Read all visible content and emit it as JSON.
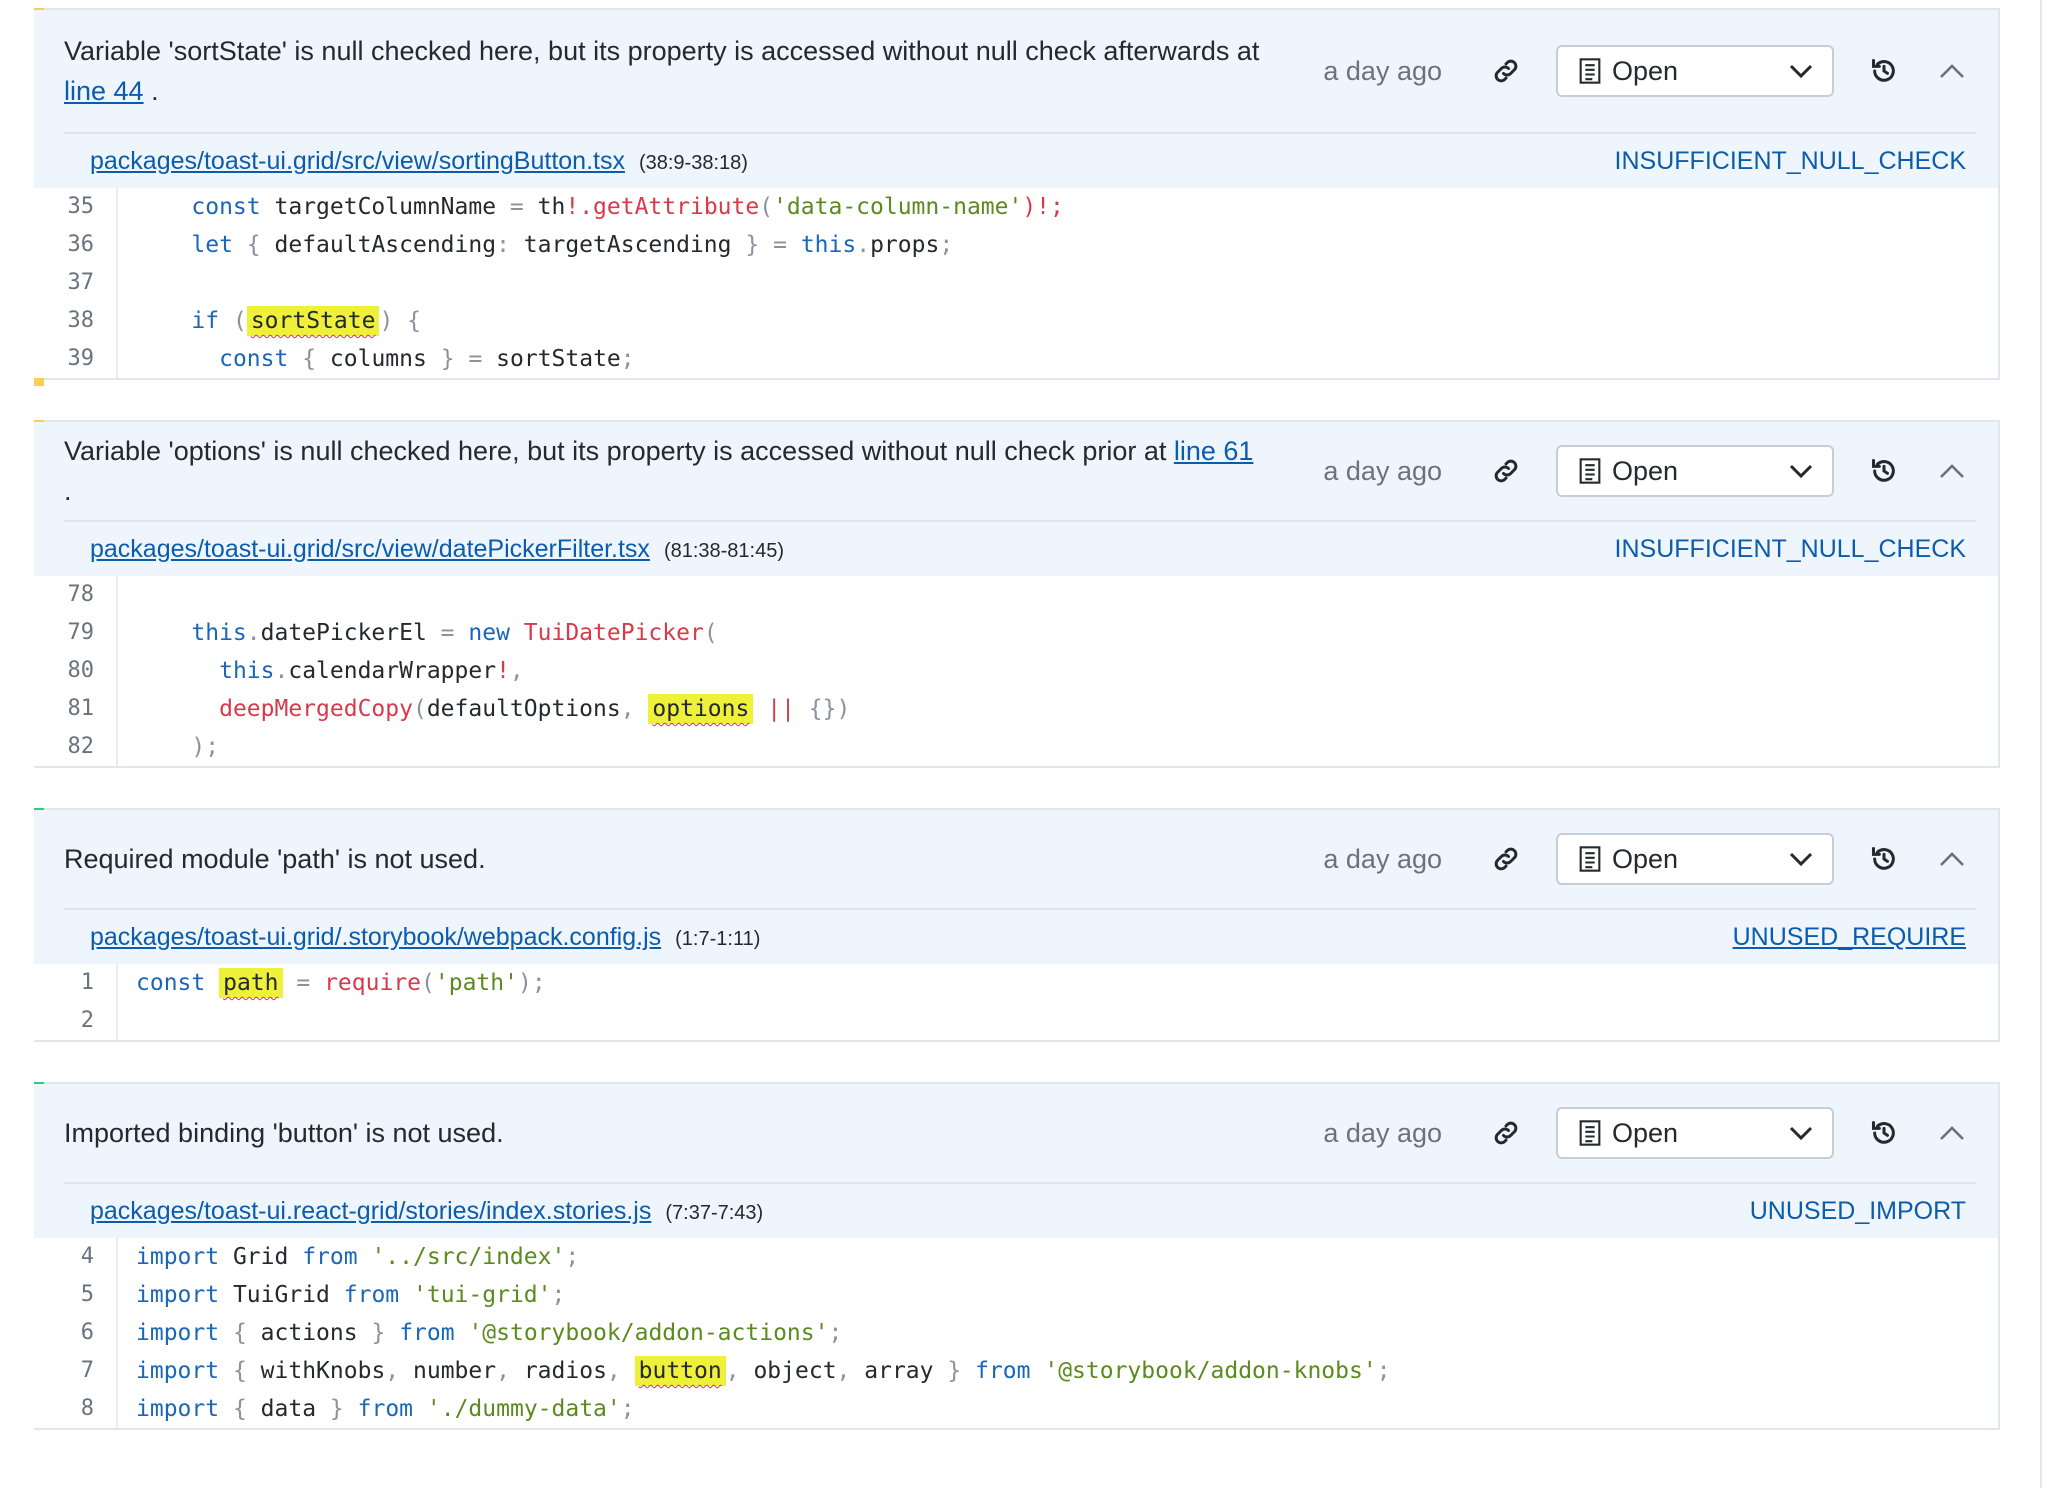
{
  "issues": [
    {
      "message_pre": "Variable 'sortState' is null checked here, but its property is accessed without null check afterwards at ",
      "message_link": "line 44",
      "message_post": " .",
      "time": "a day ago",
      "status": "Open",
      "file": "packages/toast-ui.grid/src/view/sortingButton.tsx",
      "range": "(38:9-38:18)",
      "rule": "INSUFFICIENT_NULL_CHECK",
      "lines": [
        "35",
        "36",
        "37",
        "38",
        "39"
      ]
    },
    {
      "message_pre": "Variable 'options' is null checked here, but its property is accessed without null check prior at ",
      "message_link": "line 61",
      "message_post": " .",
      "time": "a day ago",
      "status": "Open",
      "file": "packages/toast-ui.grid/src/view/datePickerFilter.tsx",
      "range": "(81:38-81:45)",
      "rule": "INSUFFICIENT_NULL_CHECK",
      "lines": [
        "78",
        "79",
        "80",
        "81",
        "82"
      ]
    },
    {
      "message_pre": "Required module 'path' is not used.",
      "time": "a day ago",
      "status": "Open",
      "file": "packages/toast-ui.grid/.storybook/webpack.config.js",
      "range": "(1:7-1:11)",
      "rule": "UNUSED_REQUIRE",
      "lines": [
        "1",
        "2"
      ]
    },
    {
      "message_pre": "Imported binding 'button' is not used.",
      "time": "a day ago",
      "status": "Open",
      "file": "packages/toast-ui.react-grid/stories/index.stories.js",
      "range": "(7:37-7:43)",
      "rule": "UNUSED_IMPORT",
      "lines": [
        "4",
        "5",
        "6",
        "7",
        "8"
      ]
    }
  ],
  "code": {
    "i0l0": [
      "const",
      "targetColumnName",
      "=",
      "th",
      "!.",
      "getAttribute",
      "(",
      "'data-column-name'",
      ")!;"
    ],
    "i0l1": [
      "let",
      "{",
      "defaultAscending",
      ":",
      "targetAscending",
      "}",
      "=",
      "this",
      ".",
      "props",
      ";"
    ],
    "i0l3": [
      "if",
      "(",
      "sortState",
      ")",
      "{"
    ],
    "i0l4": [
      "const",
      "{",
      "columns",
      "}",
      "=",
      "sortState",
      ";"
    ],
    "i1l1": [
      "this",
      ".",
      "datePickerEl",
      "=",
      "new",
      "TuiDatePicker",
      "("
    ],
    "i1l2": [
      "this",
      ".",
      "calendarWrapper",
      "!",
      ","
    ],
    "i1l3": [
      "deepMergedCopy",
      "(",
      "defaultOptions",
      ",",
      "options",
      "||",
      "{})"
    ],
    "i1l4": [
      ");"
    ],
    "i2l0": [
      "const",
      "path",
      "=",
      "require",
      "(",
      "'path'",
      ");"
    ],
    "i3l0": [
      "import",
      "Grid",
      "from",
      "'../src/index'",
      ";"
    ],
    "i3l1": [
      "import",
      "TuiGrid",
      "from",
      "'tui-grid'",
      ";"
    ],
    "i3l2": [
      "import",
      "{",
      "actions",
      "}",
      "from",
      "'@storybook/addon-actions'",
      ";"
    ],
    "i3l3": [
      "import",
      "{",
      "withKnobs",
      ",",
      "number",
      ",",
      "radios",
      ",",
      "button",
      ",",
      "object",
      ",",
      "array",
      "}",
      "from",
      "'@storybook/addon-knobs'",
      ";"
    ],
    "i3l4": [
      "import",
      "{",
      "data",
      "}",
      "from",
      "'./dummy-data'",
      ";"
    ]
  },
  "colors": {
    "warning_accent": "#f8cf55",
    "info_accent": "#2ecc80",
    "link": "#0b5cad",
    "highlight": "#eef03a"
  },
  "icons": [
    "link-icon",
    "document-icon",
    "chevron-down-icon",
    "history-icon",
    "chevron-up-icon"
  ]
}
